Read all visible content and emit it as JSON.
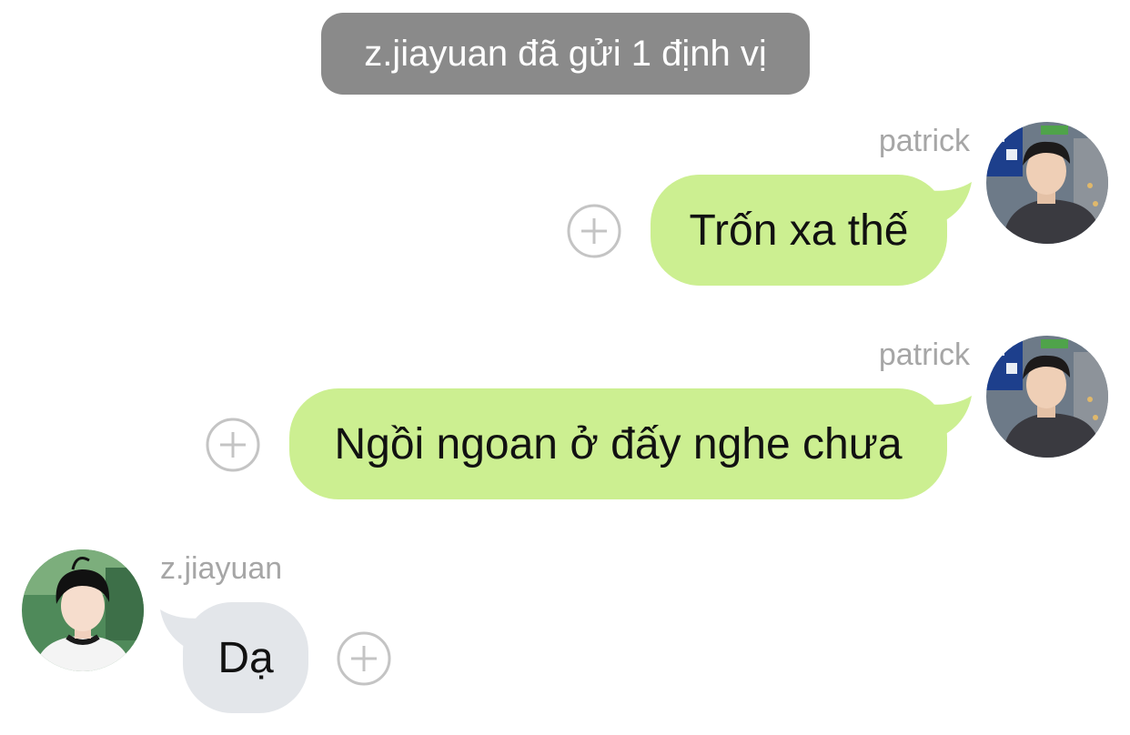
{
  "system_notice": "z.jiayuan đã gửi 1 định vị",
  "messages": [
    {
      "direction": "out",
      "sender": "patrick",
      "text": "Trốn xa thế",
      "avatar_icon": "patrick-avatar-icon"
    },
    {
      "direction": "out",
      "sender": "patrick",
      "text": "Ngồi ngoan ở đấy nghe chưa",
      "avatar_icon": "patrick-avatar-icon"
    },
    {
      "direction": "in",
      "sender": "z.jiayuan",
      "text": "Dạ",
      "avatar_icon": "jiayuan-avatar-icon"
    }
  ],
  "icons": {
    "add_reaction": "plus-circle-icon"
  },
  "colors": {
    "outgoing_bubble": "#ccef91",
    "incoming_bubble": "#e3e6ea",
    "system_pill": "#8a8a8a",
    "sender_name": "#a6a6a6"
  }
}
